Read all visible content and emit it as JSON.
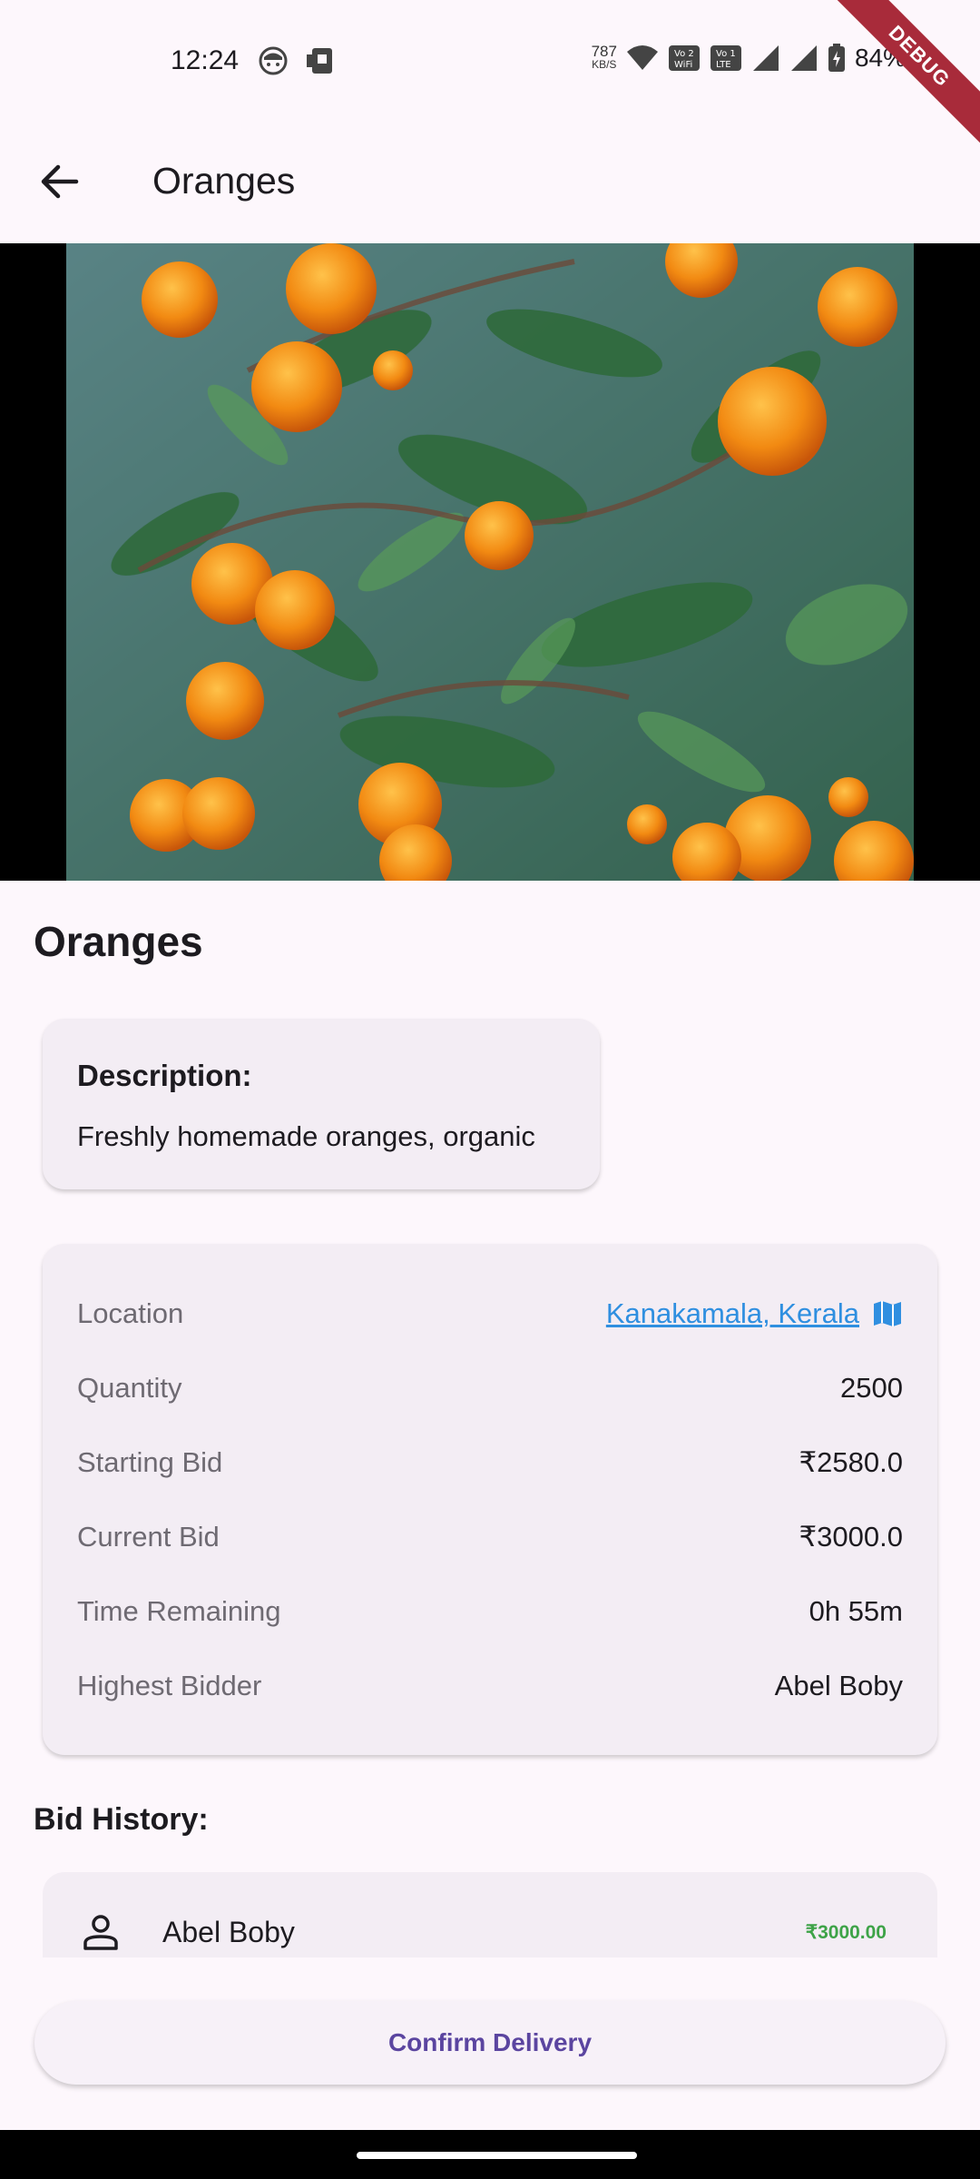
{
  "status_bar": {
    "time": "12:24",
    "net_speed_value": "787",
    "net_speed_unit": "KB/S",
    "battery_percent": "84%",
    "debug_label": "DEBUG",
    "icons": [
      "face-icon",
      "sim-card-icon",
      "wifi-icon",
      "vowifi-icon",
      "lte-icon",
      "signal-icon",
      "signal-icon",
      "battery-charging-icon"
    ]
  },
  "app_bar": {
    "title": "Oranges",
    "back_icon": "arrow-back-icon"
  },
  "product": {
    "name": "Oranges",
    "description_heading": "Description:",
    "description_text": "Freshly homemade oranges, organic"
  },
  "details": {
    "location_label": "Location",
    "location_value": "Kanakamala, Kerala",
    "location_icon": "map-icon",
    "quantity_label": "Quantity",
    "quantity_value": "2500",
    "starting_bid_label": "Starting Bid",
    "starting_bid_value": "₹2580.0",
    "current_bid_label": "Current Bid",
    "current_bid_value": "₹3000.0",
    "time_remaining_label": "Time Remaining",
    "time_remaining_value": "0h 55m",
    "highest_bidder_label": "Highest Bidder",
    "highest_bidder_value": "Abel Boby"
  },
  "bid_history": {
    "heading": "Bid History:",
    "items": [
      {
        "name": "Abel Boby",
        "amount": "₹3000.00",
        "icon": "person-icon"
      }
    ]
  },
  "actions": {
    "confirm_label": "Confirm Delivery"
  },
  "colors": {
    "background": "#fdf7fc",
    "card": "#f3edf4",
    "link": "#2f8fe0",
    "bid_amount": "#3ea348",
    "button_text": "#5b45a0",
    "debug_ribbon": "#a82b3a"
  }
}
